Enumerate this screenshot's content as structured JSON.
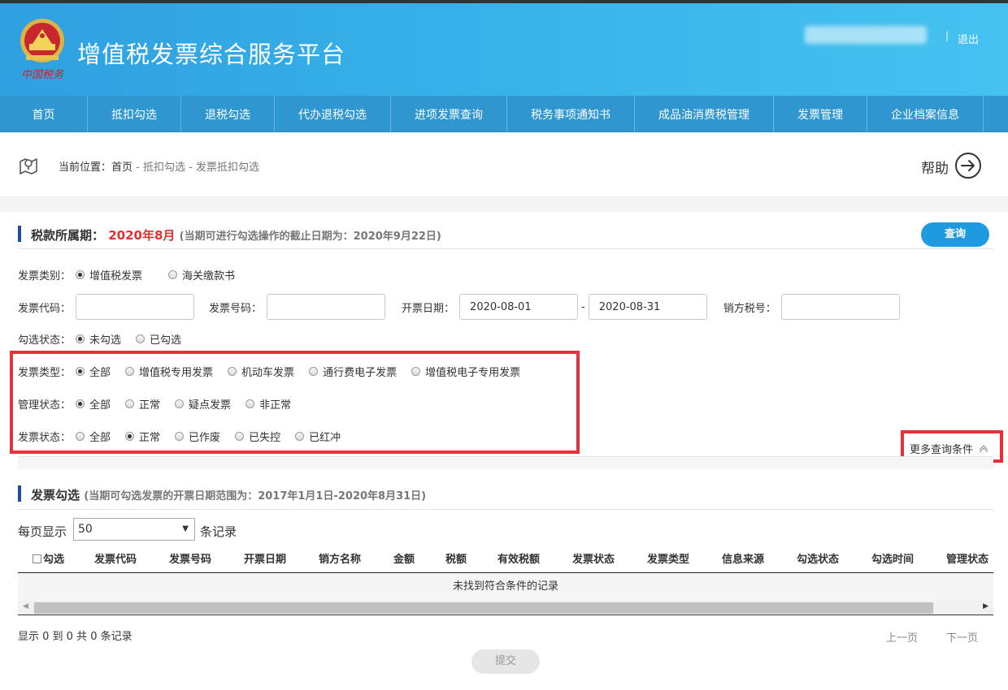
{
  "header": {
    "title": "增值税发票综合服务平台",
    "logo_text": "中国税务",
    "separator": "|",
    "logout": "退出"
  },
  "nav": [
    {
      "label": "首页",
      "w": 0
    },
    {
      "label": "抵扣勾选"
    },
    {
      "label": "退税勾选"
    },
    {
      "label": "代办退税勾选"
    },
    {
      "label": "进项发票查询"
    },
    {
      "label": "税务事项通知书"
    },
    {
      "label": "成品油消费税管理"
    },
    {
      "label": "发票管理"
    },
    {
      "label": "企业档案信息"
    }
  ],
  "breadcrumb": {
    "prefix": "当前位置：",
    "home": "首页",
    "sep": " - ",
    "level1": "抵扣勾选",
    "level2": "发票抵扣勾选"
  },
  "help_label": "帮助",
  "period": {
    "label": "税款所属期：",
    "value": "2020年8月",
    "note": "(当期可进行勾选操作的截止日期为：2020年9月22日)"
  },
  "query_button": "查询",
  "filters": {
    "invoice_category": {
      "label": "发票类别：",
      "options": [
        "增值税发票",
        "海关缴款书"
      ],
      "selected": 0
    },
    "invoice_code_label": "发票代码：",
    "invoice_code_value": "",
    "invoice_number_label": "发票号码：",
    "invoice_number_value": "",
    "issue_date_label": "开票日期：",
    "date_from": "2020-08-01",
    "date_sep": "-",
    "date_to": "2020-08-31",
    "seller_tax_label": "销方税号：",
    "seller_tax_value": "",
    "check_status": {
      "label": "勾选状态：",
      "options": [
        "未勾选",
        "已勾选"
      ],
      "selected": 0
    },
    "invoice_type": {
      "label": "发票类型：",
      "options": [
        "全部",
        "增值税专用发票",
        "机动车发票",
        "通行费电子发票",
        "增值税电子专用发票"
      ],
      "selected": 0
    },
    "manage_status": {
      "label": "管理状态：",
      "options": [
        "全部",
        "正常",
        "疑点发票",
        "非正常"
      ],
      "selected": 0
    },
    "invoice_status": {
      "label": "发票状态：",
      "options": [
        "全部",
        "正常",
        "已作废",
        "已失控",
        "已红冲"
      ],
      "selected": 1
    }
  },
  "more_conditions": "更多查询条件",
  "selection": {
    "title": "发票勾选",
    "note": "(当期可勾选发票的开票日期范围为：2017年1月1日-2020年8月31日)",
    "page_size_label": "每页显示",
    "page_size": "50",
    "page_size_suffix": "条记录",
    "columns": [
      "勾选",
      "发票代码",
      "发票号码",
      "开票日期",
      "销方名称",
      "金额",
      "税额",
      "有效税额",
      "发票状态",
      "发票类型",
      "信息来源",
      "勾选状态",
      "勾选时间",
      "管理状态"
    ],
    "empty": "未找到符合条件的记录",
    "info": "显示 0 到 0 共 0 条记录",
    "prev": "上一页",
    "next": "下一页",
    "submit": "提交"
  }
}
